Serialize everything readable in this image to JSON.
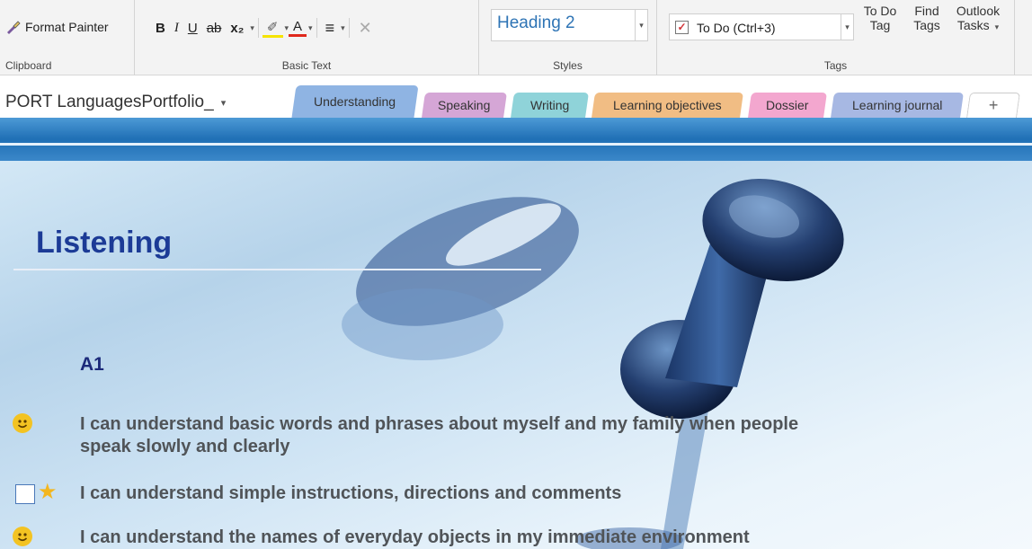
{
  "ribbon": {
    "clipboard": {
      "format_painter": "Format Painter",
      "label": "Clipboard"
    },
    "basic_text": {
      "label": "Basic Text",
      "bold": "B",
      "italic": "I",
      "underline": "U",
      "strikethrough": "ab",
      "subscript": "x₂",
      "highlight": "✐",
      "font_color": "A",
      "align": "≡",
      "clear": "✕"
    },
    "styles": {
      "current": "Heading 2",
      "label": "Styles"
    },
    "tags": {
      "current": "To Do (Ctrl+3)",
      "label": "Tags",
      "todo_tag": [
        "To Do",
        "Tag"
      ],
      "find_tags": [
        "Find",
        "Tags"
      ],
      "outlook_tasks": [
        "Outlook",
        "Tasks"
      ]
    }
  },
  "notebook": {
    "name": "PORT LanguagesPortfolio_"
  },
  "tabs": [
    {
      "label": "Understanding",
      "color": "#8fb4e3",
      "active": true
    },
    {
      "label": "Speaking",
      "color": "#d5a6d6"
    },
    {
      "label": "Writing",
      "color": "#8fd3d9"
    },
    {
      "label": "Learning objectives",
      "color": "#f1bd84"
    },
    {
      "label": "Dossier",
      "color": "#f3a7cf"
    },
    {
      "label": "Learning journal",
      "color": "#a7b8e3"
    },
    {
      "label": "+",
      "color": "#ffffff"
    }
  ],
  "page": {
    "title": "Listening",
    "level": "A1",
    "items": [
      {
        "tag": "smile",
        "lines": [
          "I can understand basic words and phrases about myself and my family when people",
          "speak slowly and clearly"
        ]
      },
      {
        "tag": "todo-star",
        "lines": [
          "I can understand simple instructions, directions and comments"
        ]
      },
      {
        "tag": "smile",
        "lines": [
          "I can understand the names of everyday objects in my immediate environment"
        ]
      }
    ]
  },
  "colors": {
    "title": "#1c3b96",
    "level": "#1c2a7a",
    "item_text": "#505458",
    "band": "#1f6fb5",
    "style_text": "#2e74b5"
  },
  "icons": {
    "format_painter": "paintbrush-icon",
    "smile": "smiley-icon",
    "todo": "checkbox-icon",
    "star": "star-icon",
    "dropdown": "chevron-down-icon"
  }
}
